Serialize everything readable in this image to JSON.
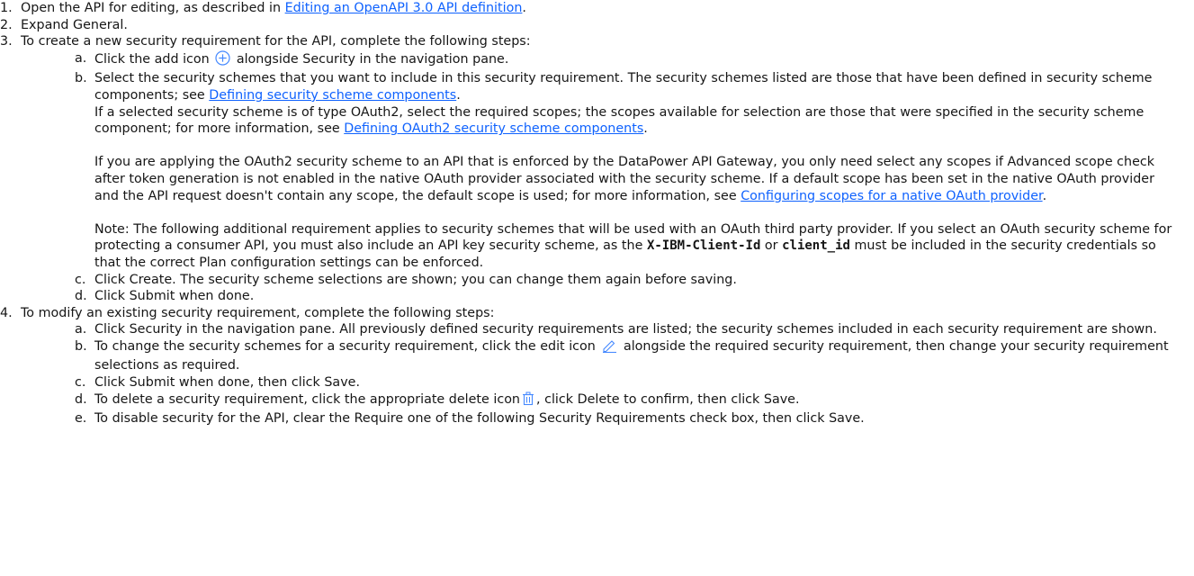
{
  "steps": [
    {
      "num": "1.",
      "pre": "Open the API for editing, as described in ",
      "link": "Editing an OpenAPI 3.0 API definition",
      "post": "."
    },
    {
      "num": "2.",
      "text": "Expand General."
    },
    {
      "num": "3.",
      "text": "To create a new security requirement for the API, complete the following steps:",
      "a": {
        "num": "a.",
        "pre": "Click the add icon",
        "post": "alongside Security in the navigation pane."
      },
      "b": {
        "num": "b.",
        "p1_pre": "Select the security schemes that you want to include in this security requirement. The security schemes listed are those that have been defined in security scheme components; see ",
        "p1_link": "Defining security scheme components",
        "p1_post": ".",
        "p2_pre": "If a selected security scheme is of type OAuth2, select the required scopes; the scopes available for selection are those that were specified in the security scheme component; for more information, see ",
        "p2_link": "Defining OAuth2 security scheme components",
        "p2_post": ".",
        "p3_pre": "If you are applying the OAuth2 security scheme to an API that is enforced by the DataPower API Gateway, you only need select any scopes if Advanced scope check after token generation is not enabled in the native OAuth provider associated with the security scheme. If a default scope has been set in the native OAuth provider and the API request doesn't contain any scope, the default scope is used; for more information, see ",
        "p3_link": "Configuring scopes for a native OAuth provider",
        "p3_post": ".",
        "p4_pre": "Note: The following additional requirement applies to security schemes that will be used with an OAuth third party provider. If you select an OAuth security scheme for protecting a consumer API, you must also include an API key security scheme, as the ",
        "p4_code1": "X-IBM-Client-Id",
        "p4_mid": " or ",
        "p4_code2": "client_id",
        "p4_post": " must be included in the security credentials so that the correct Plan configuration settings can be enforced."
      },
      "c": {
        "num": "c.",
        "text": "Click Create. The security scheme selections are shown; you can change them again before saving."
      },
      "d": {
        "num": "d.",
        "text": "Click Submit when done."
      }
    },
    {
      "num": "4.",
      "text": "To modify an existing security requirement, complete the following steps:",
      "a": {
        "num": "a.",
        "text": "Click Security in the navigation pane. All previously defined security requirements are listed; the security schemes included in each security requirement are shown."
      },
      "b": {
        "num": "b.",
        "pre": "To change the security schemes for a security requirement, click the edit icon",
        "post": "alongside the required security requirement, then change your security requirement selections as required."
      },
      "c": {
        "num": "c.",
        "text": "Click Submit when done, then click Save."
      },
      "d": {
        "num": "d.",
        "pre": "To delete a security requirement, click the appropriate delete icon",
        "post": ", click Delete to confirm, then click Save."
      },
      "e": {
        "num": "e.",
        "text": "To disable security for the API, clear the Require one of the following Security Requirements check box, then click Save."
      }
    }
  ],
  "icons": {
    "add": "add-circle-icon",
    "edit": "edit-pencil-icon",
    "delete": "trash-icon"
  },
  "colors": {
    "link": "#0f62fe",
    "icon": "#4589ff",
    "text": "#161616"
  }
}
